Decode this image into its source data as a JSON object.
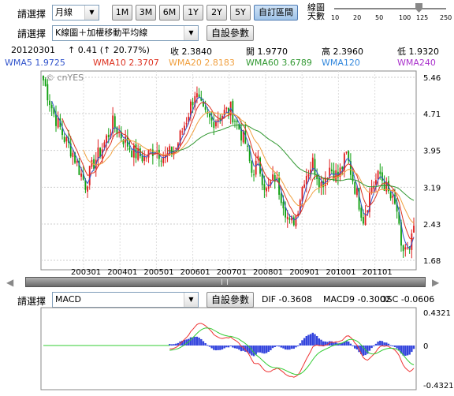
{
  "toolbar": {
    "select_label": "請選擇",
    "period_value": "月線",
    "ranges": [
      "1M",
      "3M",
      "6M",
      "1Y",
      "2Y",
      "5Y",
      "自訂區間"
    ],
    "active_range": "自訂區間",
    "days_label_1": "線圖",
    "days_label_2": "天數",
    "slider_ticks": [
      "10",
      "20",
      "50",
      "100",
      "125",
      "250"
    ],
    "slider_value": 125
  },
  "indicator_bar": {
    "select_label": "請選擇",
    "indicator_value": "K線圖＋加權移動平均線",
    "settings_button": "自設參數"
  },
  "quote": {
    "date": "20120301",
    "change": "↑ 0.41 (↑ 20.77%)",
    "close": "收 2.3840",
    "open": "開 1.9770",
    "high": "高 2.3960",
    "low": "低 1.9320"
  },
  "ma_legend": [
    {
      "text": "WMA5 1.9725",
      "color": "#3355cc"
    },
    {
      "text": "WMA10 2.3707",
      "color": "#dd3322"
    },
    {
      "text": "WMA20 2.8183",
      "color": "#f0a040"
    },
    {
      "text": "WMA60 3.6789",
      "color": "#339933"
    },
    {
      "text": "WMA120",
      "color": "#3388dd"
    },
    {
      "text": "WMA240",
      "color": "#aa33cc"
    }
  ],
  "watermark": "© cnYES",
  "chart_data": [
    {
      "type": "candlestick",
      "y_ticks": [
        "5.46",
        "4.71",
        "3.95",
        "3.19",
        "2.43",
        "1.68"
      ],
      "ylim": [
        1.68,
        5.46
      ],
      "x_ticks": [
        "200301",
        "200401",
        "200501",
        "200601",
        "200701",
        "200801",
        "200901",
        "201001",
        "201101"
      ],
      "series": [
        {
          "name": "WMA5",
          "color": "#3355cc"
        },
        {
          "name": "WMA10",
          "color": "#dd3322"
        },
        {
          "name": "WMA20",
          "color": "#f0a040"
        },
        {
          "name": "WMA60",
          "color": "#339933"
        }
      ],
      "waypoints": [
        [
          0,
          5.4
        ],
        [
          5,
          4.7
        ],
        [
          10,
          4.2
        ],
        [
          14,
          3.9
        ],
        [
          18,
          3.45
        ],
        [
          20,
          3.25
        ],
        [
          24,
          3.7
        ],
        [
          28,
          4.0
        ],
        [
          33,
          4.5
        ],
        [
          38,
          4.2
        ],
        [
          43,
          3.9
        ],
        [
          48,
          3.8
        ],
        [
          53,
          4.0
        ],
        [
          58,
          3.8
        ],
        [
          63,
          4.0
        ],
        [
          68,
          4.6
        ],
        [
          72,
          5.15
        ],
        [
          76,
          4.7
        ],
        [
          80,
          4.55
        ],
        [
          85,
          4.7
        ],
        [
          89,
          4.8
        ],
        [
          93,
          4.4
        ],
        [
          96,
          4.1
        ],
        [
          99,
          3.5
        ],
        [
          102,
          3.7
        ],
        [
          106,
          3.1
        ],
        [
          110,
          3.4
        ],
        [
          114,
          2.9
        ],
        [
          117,
          2.4
        ],
        [
          120,
          2.6
        ],
        [
          124,
          3.4
        ],
        [
          128,
          3.7
        ],
        [
          132,
          3.25
        ],
        [
          136,
          3.6
        ],
        [
          140,
          3.4
        ],
        [
          144,
          3.85
        ],
        [
          148,
          3.2
        ],
        [
          152,
          2.55
        ],
        [
          156,
          3.2
        ],
        [
          160,
          3.45
        ],
        [
          164,
          3.05
        ],
        [
          168,
          2.7
        ],
        [
          170,
          1.85
        ],
        [
          172,
          1.95
        ],
        [
          174,
          1.8
        ],
        [
          176,
          2.38
        ]
      ]
    },
    {
      "type": "macd",
      "y_ticks": [
        "0.4321",
        "0",
        "-0.4321"
      ],
      "ylim": [
        -0.4321,
        0.4321
      ],
      "series": [
        {
          "name": "DIF",
          "color": "#ee3333"
        },
        {
          "name": "MACD9",
          "color": "#33cc33"
        },
        {
          "name": "OSC",
          "color": "#3344dd"
        }
      ]
    }
  ],
  "macd_bar": {
    "select_label": "請選擇",
    "indicator_value": "MACD",
    "settings_button": "自設參數",
    "dif": "DIF -0.3608",
    "macd9": "MACD9 -0.3002",
    "osc": "OSC -0.0606"
  },
  "scroll": {
    "left_arrow": "◀",
    "right_arrow": "▶"
  }
}
